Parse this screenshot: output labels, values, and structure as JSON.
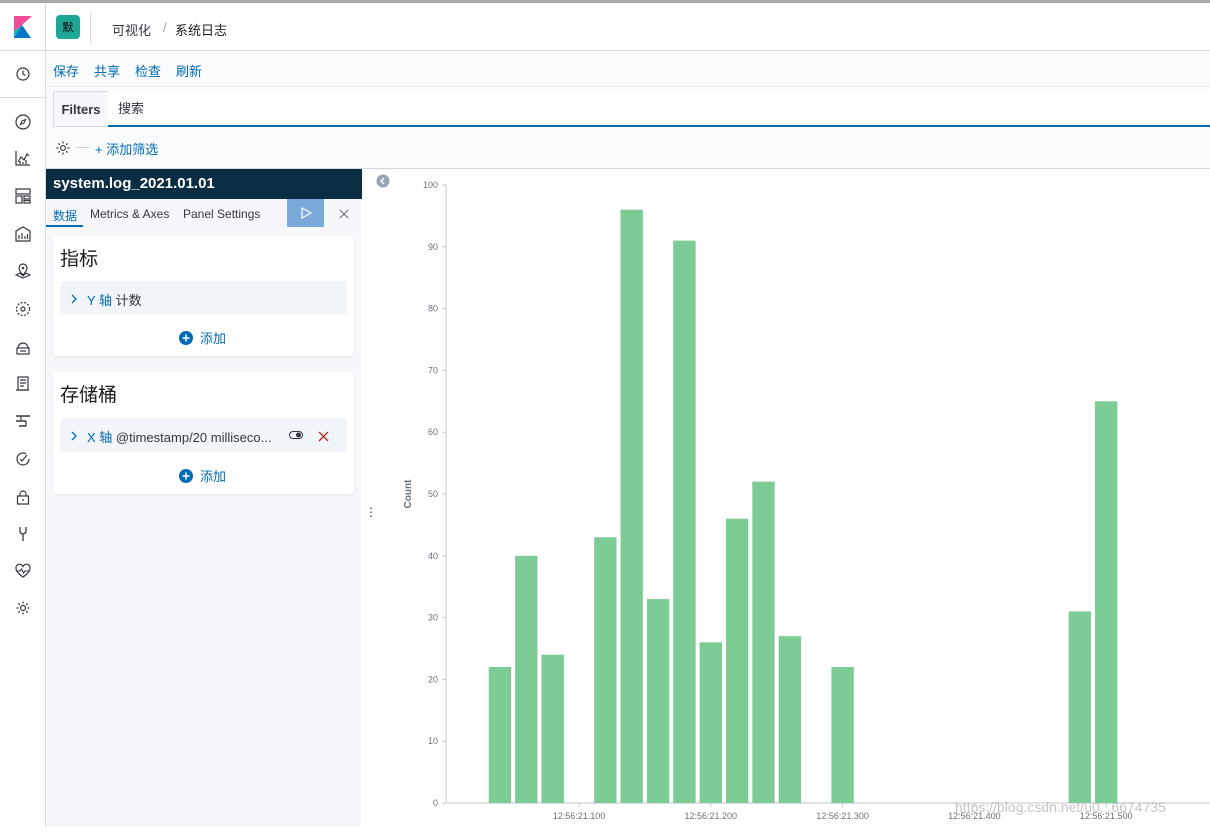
{
  "header": {
    "space_initial": "默",
    "breadcrumb_parent": "可视化",
    "breadcrumb_sep": "/",
    "breadcrumb_current": "系统日志"
  },
  "sidenav": {
    "items": [
      "clock-icon",
      "compass-icon",
      "chart-icon",
      "dashboard-icon",
      "canvas-icon",
      "maps-icon",
      "ml-icon",
      "infra-icon",
      "logs-icon",
      "apm-icon",
      "uptime-icon",
      "security-icon",
      "devtools-icon",
      "monitoring-icon",
      "management-icon"
    ]
  },
  "menu": {
    "save": "保存",
    "share": "共享",
    "inspect": "检查",
    "refresh": "刷新"
  },
  "filters": {
    "label": "Filters",
    "search_placeholder": "搜索",
    "add_filter": "+ 添加筛选",
    "dash": "—"
  },
  "editor": {
    "title": "system.log_2021.01.01",
    "tabs": [
      "数据",
      "Metrics & Axes",
      "Panel Settings"
    ],
    "metrics": {
      "heading": "指标",
      "axis_label": "Y 轴",
      "agg_text": " 计数",
      "add": "添加"
    },
    "buckets": {
      "heading": "存储桶",
      "axis_label": "X 轴",
      "agg_text": " @timestamp/20 milliseco...",
      "add": "添加"
    }
  },
  "colors": {
    "bar": "#7dcc96",
    "accent": "#006bb4",
    "panel_header": "#0b2d44"
  },
  "watermark": "https://blog.csdn.net/u0...6674735",
  "chart_data": {
    "type": "bar",
    "ylabel": "Count",
    "xlabel": "",
    "ylim": [
      0,
      100
    ],
    "yticks": [
      0,
      10,
      20,
      30,
      40,
      50,
      60,
      70,
      80,
      90,
      100
    ],
    "xticks": [
      {
        "label": "12:56:21.100",
        "ms": 100
      },
      {
        "label": "12:56:21.200",
        "ms": 200
      },
      {
        "label": "12:56:21.300",
        "ms": 300
      },
      {
        "label": "12:56:21.400",
        "ms": 400
      },
      {
        "label": "12:56:21.500",
        "ms": 500
      }
    ],
    "bucket_ms": 20,
    "bars": [
      {
        "ms": 40,
        "value": 22
      },
      {
        "ms": 60,
        "value": 40
      },
      {
        "ms": 80,
        "value": 24
      },
      {
        "ms": 120,
        "value": 43
      },
      {
        "ms": 140,
        "value": 96
      },
      {
        "ms": 160,
        "value": 33
      },
      {
        "ms": 180,
        "value": 91
      },
      {
        "ms": 200,
        "value": 26
      },
      {
        "ms": 220,
        "value": 46
      },
      {
        "ms": 240,
        "value": 52
      },
      {
        "ms": 260,
        "value": 27
      },
      {
        "ms": 300,
        "value": 22
      },
      {
        "ms": 480,
        "value": 31
      },
      {
        "ms": 500,
        "value": 65
      }
    ],
    "grid": false,
    "legend": "none"
  }
}
